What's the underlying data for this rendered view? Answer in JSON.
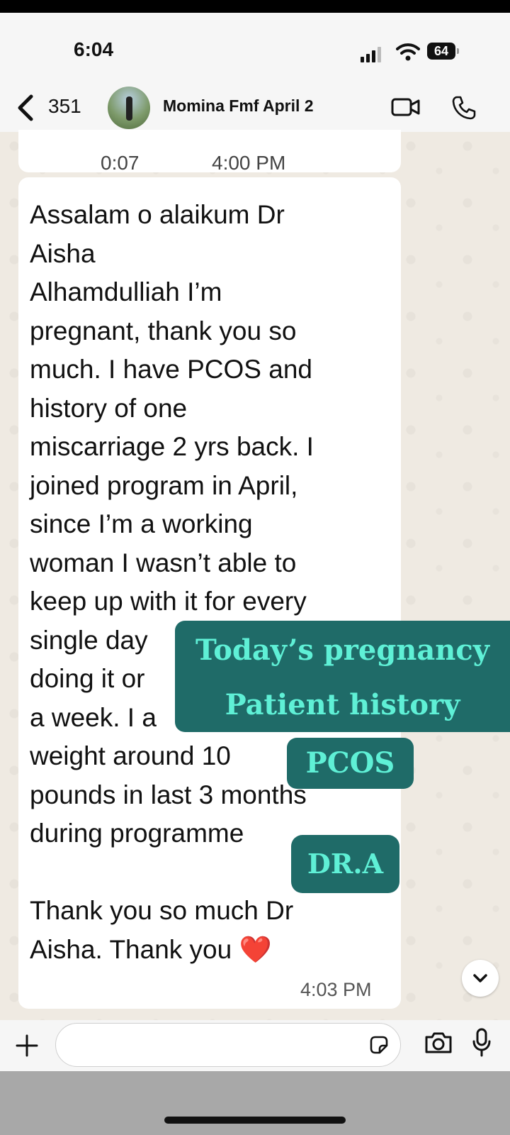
{
  "status_bar": {
    "time": "6:04",
    "battery": "64"
  },
  "header": {
    "back_count": "351",
    "contact_name": "Momina Fmf  April 2"
  },
  "voice_note": {
    "duration": "0:07",
    "time": "4:00 PM"
  },
  "message": {
    "text": "Assalam o alaikum Dr\nAisha\nAlhamdulliah I’m\npregnant, thank you so\nmuch. I have PCOS and\nhistory of one\nmiscarriage 2 yrs back. I\njoined program in April,\nsince I’m a working\nwoman I wasn’t able to\nkeep up with it for every\nsingle day\ndoing it or\na week. I a\nweight around 10\npounds in last 3 months\nduring programme\n\nThank you so much Dr\nAisha. Thank you ❤️",
    "time": "4:03 PM"
  },
  "overlays": {
    "line1": "Today’s pregnancy",
    "line2": "Patient history",
    "pcos": "PCOS",
    "signature": "DR.A"
  },
  "colors": {
    "overlay_bg": "#1f6b68",
    "overlay_text": "#5ff0d6",
    "chat_bg": "#efeae2"
  }
}
